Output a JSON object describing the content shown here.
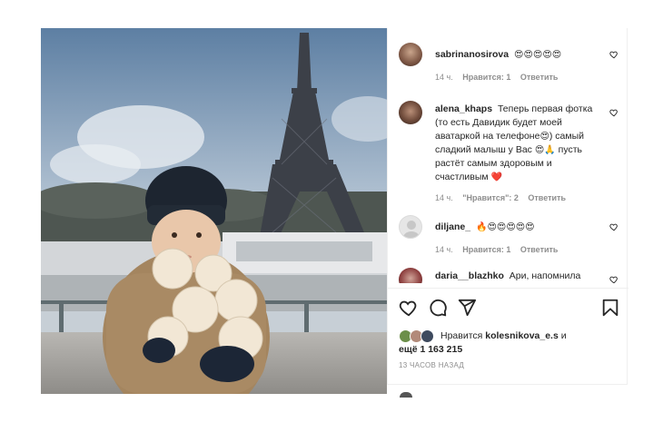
{
  "comments": [
    {
      "user": "sabrinanosirova",
      "text": "",
      "emoji": "😍😍😍😍😍",
      "time": "14 ч.",
      "likes": "Нравится: 1",
      "reply": "Ответить"
    },
    {
      "user": "alena_khaps",
      "text": "Теперь первая фотка (то есть Давидик будет моей аватаркой на телефоне",
      "text2": ") самый сладкий малыш у Вас ",
      "text3": " пусть растёт самым здоровым и счастливым ",
      "emoji1": "😍",
      "emoji2": "😍🙏",
      "emoji3": "❤️",
      "time": "14 ч.",
      "likes": "\"Нравится\": 2",
      "reply": "Ответить"
    },
    {
      "user": "diljane_",
      "text": "",
      "emoji": "🔥😍😍😍😍😍",
      "time": "14 ч.",
      "likes": "Нравится: 1",
      "reply": "Ответить"
    },
    {
      "user": "daria__blazhko",
      "text": "Ари, напомнила",
      "emoji": "",
      "time": "",
      "likes": "",
      "reply": ""
    }
  ],
  "likes": {
    "prefix": "Нравится",
    "user": "kolesnikova_e.s",
    "and": "и",
    "count": "ещё 1 163 215"
  },
  "timestamp": "13 ЧАСОВ НАЗАД",
  "icons": {
    "like": "heart-icon",
    "comment": "comment-icon",
    "share": "share-icon",
    "save": "bookmark-icon",
    "next": "chevron-right-icon"
  },
  "colors": {
    "text": "#262626",
    "muted": "#8e8e8e",
    "heart": "#ed4956"
  }
}
